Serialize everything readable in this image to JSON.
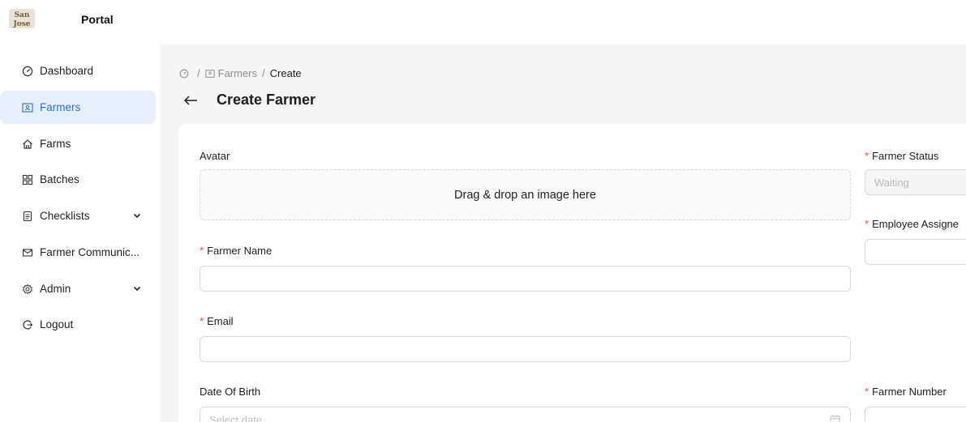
{
  "app": {
    "name": "Portal",
    "logo_text": "San Jose"
  },
  "sidebar": {
    "items": [
      {
        "label": "Dashboard",
        "icon": "dashboard-icon"
      },
      {
        "label": "Farmers",
        "icon": "contacts-icon",
        "active": true
      },
      {
        "label": "Farms",
        "icon": "home-icon"
      },
      {
        "label": "Batches",
        "icon": "batches-icon"
      },
      {
        "label": "Checklists",
        "icon": "checklist-icon",
        "expandable": true
      },
      {
        "label": "Farmer Communic...",
        "icon": "mail-icon"
      },
      {
        "label": "Admin",
        "icon": "settings-icon",
        "expandable": true
      },
      {
        "label": "Logout",
        "icon": "logout-icon"
      }
    ]
  },
  "breadcrumb": {
    "items": [
      "Farmers",
      "Create"
    ],
    "separator": "/"
  },
  "page": {
    "title": "Create Farmer"
  },
  "form": {
    "avatar": {
      "label": "Avatar",
      "dropzone_text": "Drag & drop an image here"
    },
    "farmer_name": {
      "label": "Farmer Name",
      "required": "*",
      "value": ""
    },
    "email": {
      "label": "Email",
      "required": "*",
      "value": ""
    },
    "date_of_birth": {
      "label": "Date Of Birth",
      "placeholder": "Select date"
    },
    "farmer_status": {
      "label": "Farmer Status",
      "required": "*",
      "value": "Waiting"
    },
    "employee_assigned": {
      "label": "Employee Assigne",
      "required": "*",
      "value": ""
    },
    "farmer_number": {
      "label": "Farmer Number",
      "required": "*",
      "value": ""
    }
  },
  "colors": {
    "accent": "#2a6fdb",
    "active_bg": "#e6f0fd",
    "required": "#ff4d4f",
    "main_bg": "#f5f5f5"
  }
}
